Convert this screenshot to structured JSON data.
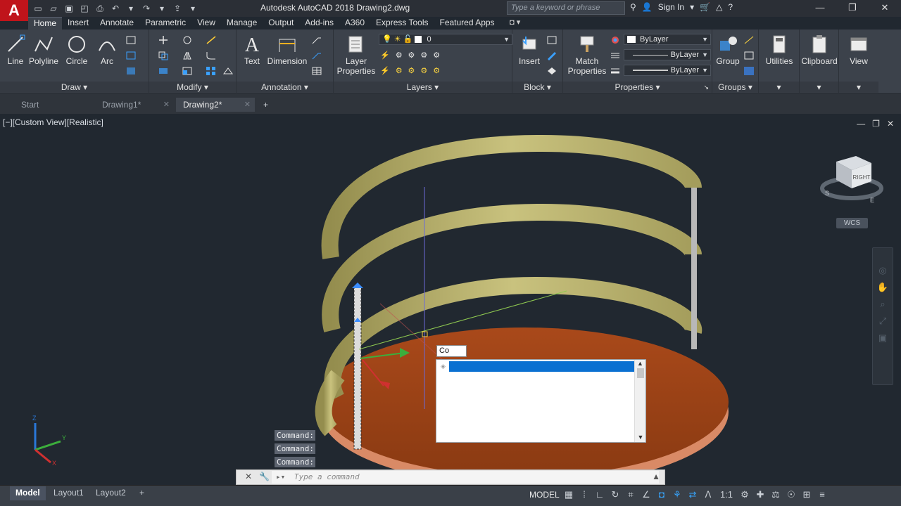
{
  "app": {
    "logo": "A",
    "title": "Autodesk AutoCAD 2018   Drawing2.dwg"
  },
  "search": {
    "placeholder": "Type a keyword or phrase"
  },
  "signin": "Sign In",
  "ribbon_tabs": [
    "Home",
    "Insert",
    "Annotate",
    "Parametric",
    "View",
    "Manage",
    "Output",
    "Add-ins",
    "A360",
    "Express Tools",
    "Featured Apps"
  ],
  "draw": {
    "title": "Draw",
    "line": "Line",
    "polyline": "Polyline",
    "circle": "Circle",
    "arc": "Arc"
  },
  "modify": {
    "title": "Modify"
  },
  "annotation": {
    "title": "Annotation",
    "text": "Text",
    "dimension": "Dimension"
  },
  "layers": {
    "title": "Layers",
    "layer_properties": "Layer Properties",
    "current_layer": "0"
  },
  "block": {
    "title": "Block",
    "insert": "Insert"
  },
  "properties": {
    "title": "Properties",
    "match_properties": "Match Properties",
    "color": "ByLayer",
    "linetype": "ByLayer",
    "lineweight": "ByLayer"
  },
  "groups": {
    "title": "Groups",
    "group": "Group"
  },
  "utilities": "Utilities",
  "clipboard": "Clipboard",
  "view_panel": "View",
  "file_tabs": [
    "Start",
    "Drawing1*",
    "Drawing2*"
  ],
  "viewport": {
    "label": "[−][Custom View][Realistic]",
    "wcs": "WCS",
    "cube_face": "RIGHT"
  },
  "dynamic_input": {
    "value": "Co"
  },
  "command_history": [
    "Command:",
    "Command:",
    "Command:"
  ],
  "command_line": {
    "placeholder": "Type a command"
  },
  "layout_tabs": [
    "Model",
    "Layout1",
    "Layout2"
  ],
  "status": {
    "model": "MODEL",
    "scale": "1:1"
  },
  "colors": {
    "accent": "#0a70d1",
    "brand_red": "#c0141b",
    "ring": "#b9b36a",
    "disc": "#9b4416"
  }
}
